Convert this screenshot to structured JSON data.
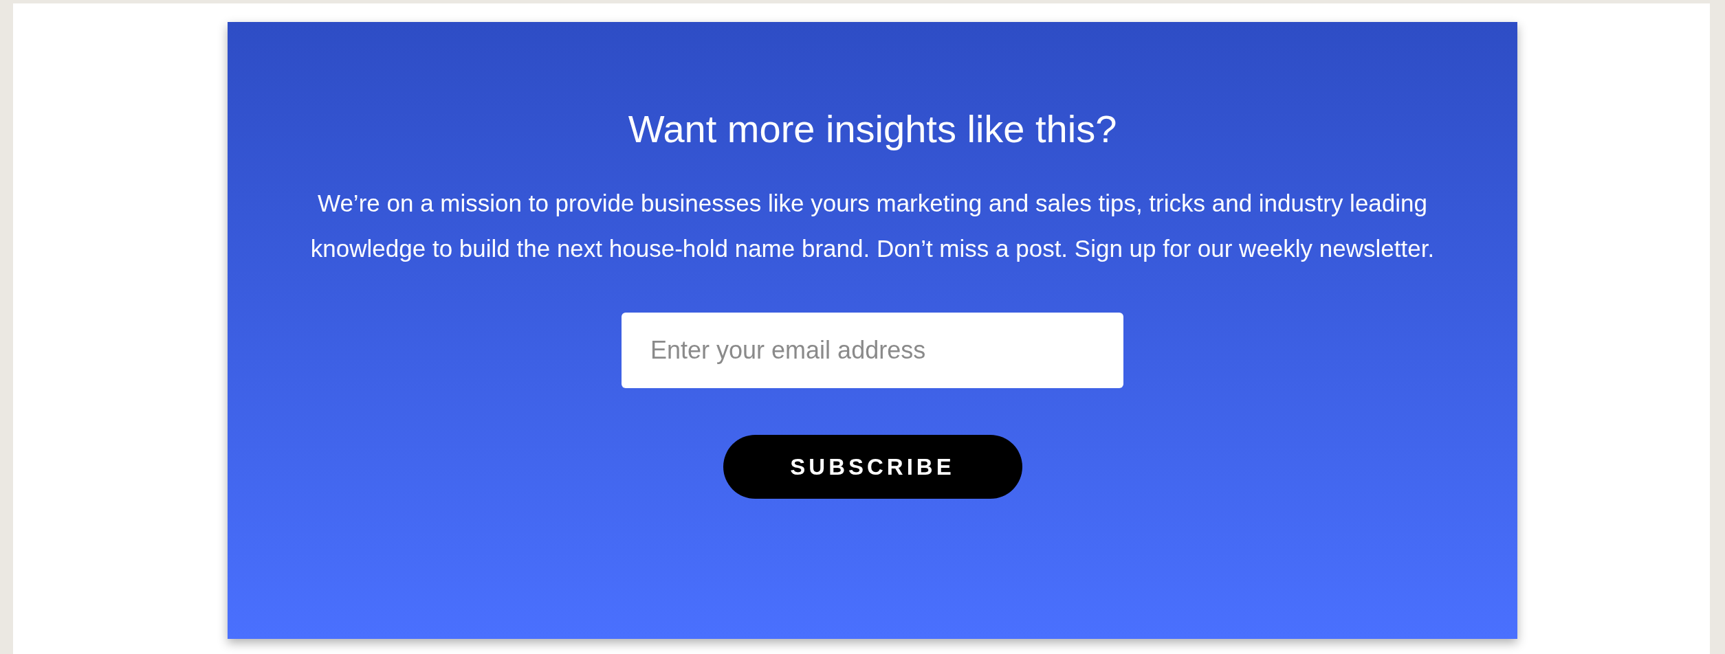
{
  "newsletter": {
    "heading": "Want more insights like this?",
    "description": "We’re on a mission to provide businesses like yours marketing and sales tips, tricks and industry leading knowledge to build the next house-hold name brand. Don’t miss a post. Sign up for our weekly newsletter.",
    "email_field": {
      "placeholder": "Enter your email address"
    },
    "subscribe_button": {
      "label": "SUBSCRIBE"
    }
  }
}
